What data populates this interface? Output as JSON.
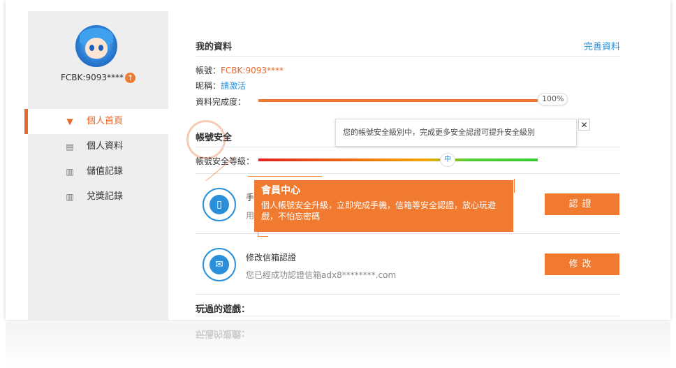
{
  "user": {
    "id_label": "FCBK:9093****",
    "level_badge": "↑"
  },
  "nav": [
    {
      "label": "個人首頁",
      "icon": "tie-icon",
      "active": true
    },
    {
      "label": "個人資料",
      "icon": "id-card-icon",
      "active": false
    },
    {
      "label": "儲值記錄",
      "icon": "clipboard-icon",
      "active": false
    },
    {
      "label": "兌獎記錄",
      "icon": "clipboard-icon",
      "active": false
    }
  ],
  "profile": {
    "title": "我的資料",
    "complete_link": "完善資料",
    "account_label": "帳號：",
    "account_value": "FCBK:9093****",
    "nickname_label": "昵稱：",
    "nickname_value": "請激活",
    "completeness_label": "資料完成度：",
    "completeness_value": "100%",
    "completeness": 1.0
  },
  "security": {
    "title": "帳號安全",
    "level_label": "帳號安全等級：",
    "level_value": "中",
    "tooltip": "您的帳號安全級別中，完成更多安全認證可提升安全級別",
    "close_glyph": "✕",
    "phone": {
      "title": "手",
      "desc": "用",
      "button": "認證"
    },
    "email": {
      "title": "修改信箱認證",
      "desc": "您已經成功認證信箱adx8********.com",
      "button": "修改"
    }
  },
  "callout": {
    "title": "會員中心",
    "body": "個人帳號安全升級，立即完成手機，信箱等安全認證，放心玩遊戲，不怕忘密碼"
  },
  "games": {
    "title": "玩過的遊戲："
  },
  "colors": {
    "accent": "#f07a30",
    "link": "#2a8fd8"
  }
}
